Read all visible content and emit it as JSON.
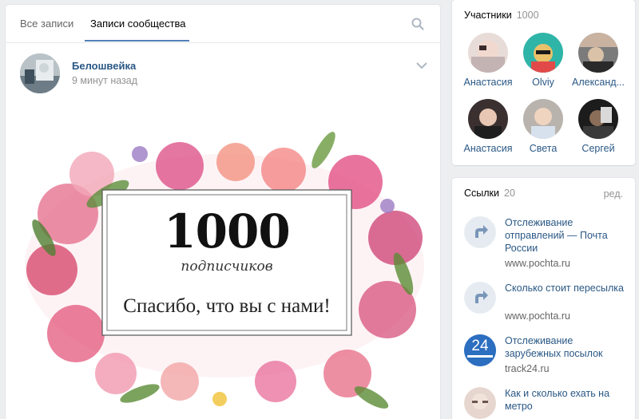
{
  "feed": {
    "tabs": [
      {
        "label": "Все записи"
      },
      {
        "label": "Записи сообщества"
      }
    ],
    "post": {
      "author": "Белошвейка",
      "time": "9 минут назад",
      "image": {
        "number": "1000",
        "subtitle": "подписчиков",
        "message": "Спасибо, что вы с нами!"
      }
    }
  },
  "members": {
    "title": "Участники",
    "count": "1000",
    "items": [
      {
        "name": "Анастасия"
      },
      {
        "name": "Olviy"
      },
      {
        "name": "Александ..."
      },
      {
        "name": "Анастасия"
      },
      {
        "name": "Света"
      },
      {
        "name": "Сергей"
      }
    ]
  },
  "links": {
    "title": "Ссылки",
    "count": "20",
    "edit": "ред.",
    "items": [
      {
        "title": "Отслеживание отправлений — Почта России",
        "url": "www.pochta.ru"
      },
      {
        "title": "Сколько стоит пересылка",
        "url": "www.pochta.ru"
      },
      {
        "title": "Отслеживание зарубежных посылок",
        "url": "track24.ru",
        "badge": "24"
      },
      {
        "title": "Как и сколько ехать на метро",
        "url": ""
      }
    ]
  },
  "colors": {
    "link": "#2a5885",
    "accent": "#5181b8",
    "muted": "#939393"
  }
}
